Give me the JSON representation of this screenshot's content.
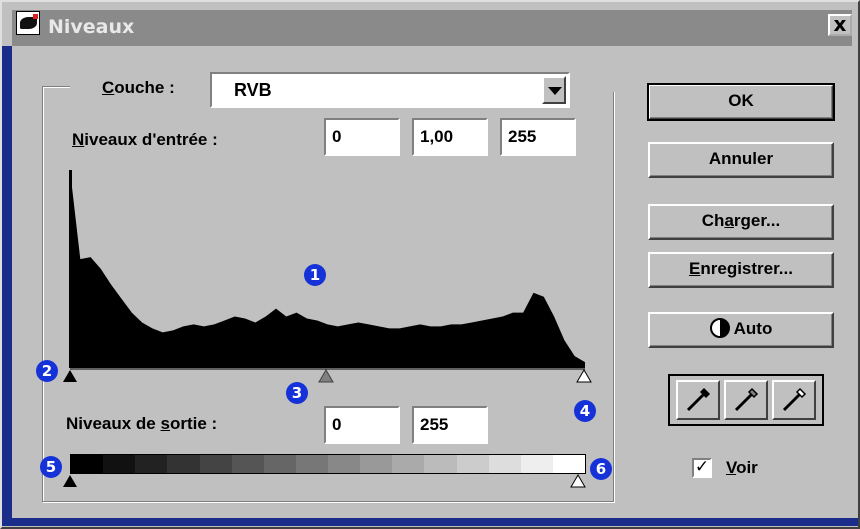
{
  "window": {
    "title": "Niveaux",
    "close_glyph": "x"
  },
  "channel": {
    "label_prefix": "C",
    "label_rest": "ouche :",
    "value": "RVB"
  },
  "input_levels": {
    "label_prefix": "N",
    "label_rest": "iveaux d'entrée :",
    "black": "0",
    "gamma": "1,00",
    "white": "255"
  },
  "output_levels": {
    "label_before": "Niveaux de ",
    "label_underlined": "s",
    "label_after": "ortie :",
    "black": "0",
    "white": "255"
  },
  "buttons": {
    "ok": "OK",
    "cancel": "Annuler",
    "load_prefix": "Ch",
    "load_underlined": "a",
    "load_rest": "rger...",
    "save_underlined": "E",
    "save_rest": "nregistrer...",
    "auto": "Auto"
  },
  "preview": {
    "checked_glyph": "✓",
    "label_underlined": "V",
    "label_rest": "oir",
    "checked": true
  },
  "callouts": [
    "1",
    "2",
    "3",
    "4",
    "5",
    "6"
  ],
  "colors": {
    "titlebar": "#8a8a8a",
    "face": "#c0c0c0",
    "frame": "#1a2d8a",
    "callout": "#1432d8"
  },
  "icons": [
    "black-eyedropper-icon",
    "gray-eyedropper-icon",
    "white-eyedropper-icon",
    "auto-contrast-icon",
    "app-icon"
  ],
  "chart_data": {
    "type": "area",
    "x": [
      0,
      2,
      4,
      6,
      8,
      10,
      12,
      14,
      16,
      18,
      20,
      22,
      24,
      26,
      28,
      30,
      32,
      34,
      36,
      38,
      40,
      42,
      44,
      46,
      48,
      50,
      52,
      54,
      56,
      58,
      60,
      62,
      64,
      66,
      68,
      70,
      72,
      74,
      76,
      78,
      80,
      82,
      84,
      86,
      88,
      90,
      92,
      94,
      96,
      98,
      100
    ],
    "values": [
      100,
      55,
      56,
      50,
      42,
      35,
      28,
      23,
      20,
      18,
      19,
      21,
      22,
      21,
      22,
      24,
      26,
      25,
      23,
      26,
      30,
      26,
      28,
      25,
      24,
      22,
      21,
      22,
      23,
      22,
      21,
      20,
      20,
      21,
      22,
      21,
      21,
      22,
      22,
      23,
      24,
      25,
      26,
      28,
      28,
      38,
      36,
      26,
      14,
      6,
      3
    ],
    "xlim": [
      0,
      100
    ],
    "ylim": [
      0,
      100
    ]
  }
}
